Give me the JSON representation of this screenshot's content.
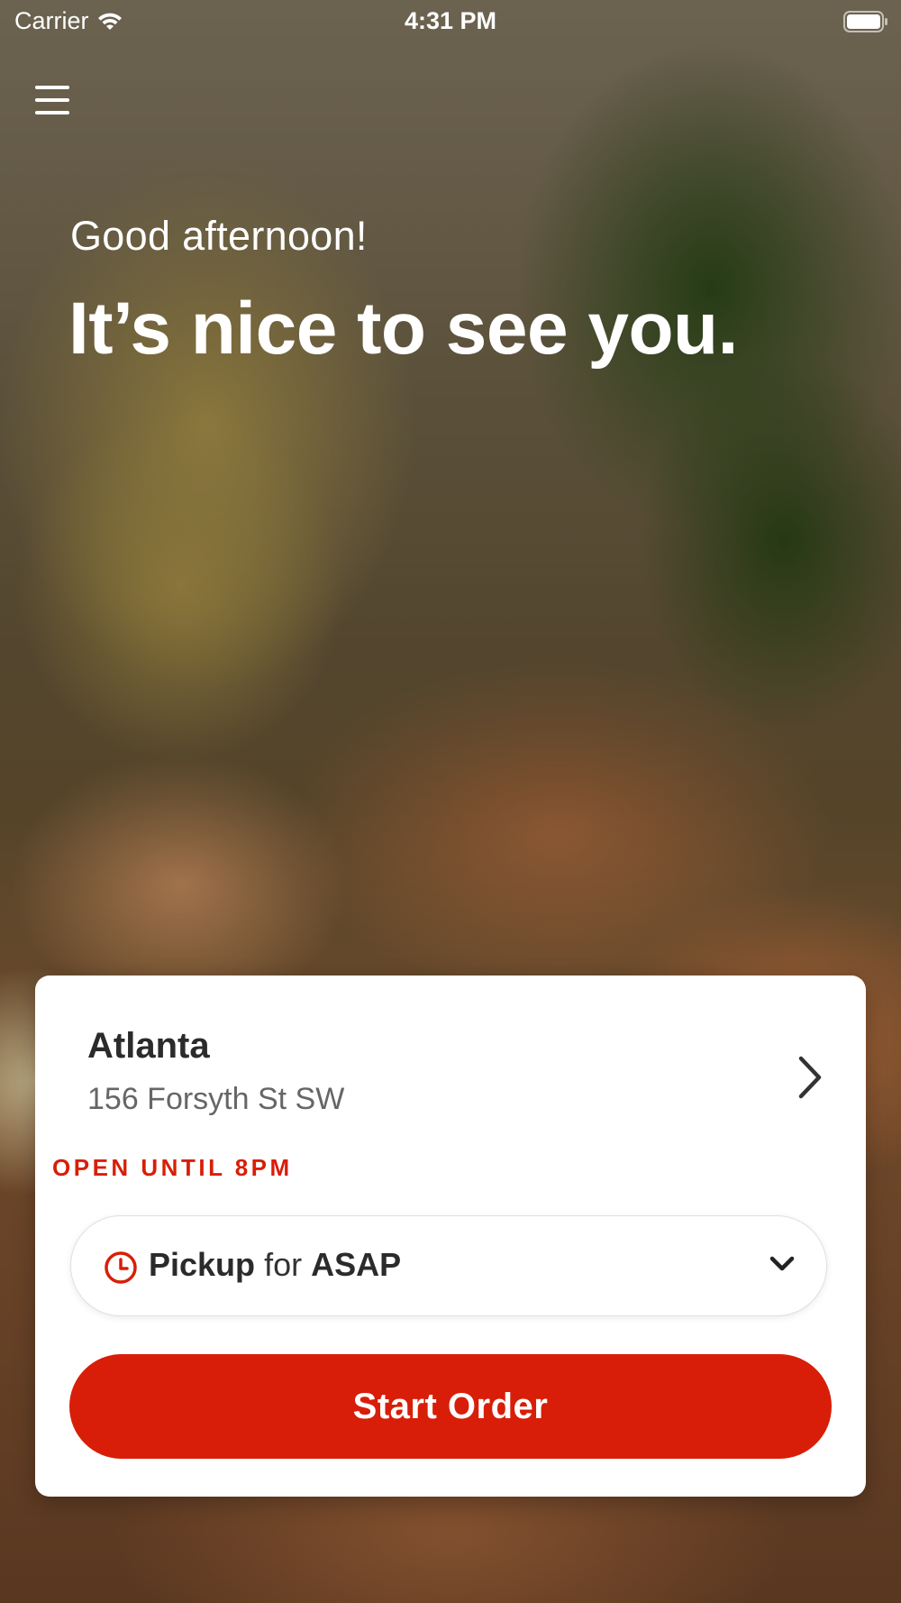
{
  "status_bar": {
    "carrier": "Carrier",
    "time": "4:31 PM"
  },
  "hero": {
    "greeting": "Good afternoon!",
    "headline": "It’s nice to see you."
  },
  "location": {
    "name": "Atlanta",
    "address": "156 Forsyth St SW",
    "status": "OPEN UNTIL 8PM"
  },
  "order_type": {
    "mode": "Pickup",
    "connector": "for",
    "when": "ASAP"
  },
  "start_order_label": "Start Order",
  "colors": {
    "accent": "#d81e08",
    "card_background": "#ffffff",
    "text_dark": "#2b2b2b",
    "text_muted": "#666666"
  },
  "icons": [
    "wifi-icon",
    "battery-icon",
    "hamburger-menu-icon",
    "chevron-right-icon",
    "clock-icon",
    "chevron-down-icon"
  ]
}
